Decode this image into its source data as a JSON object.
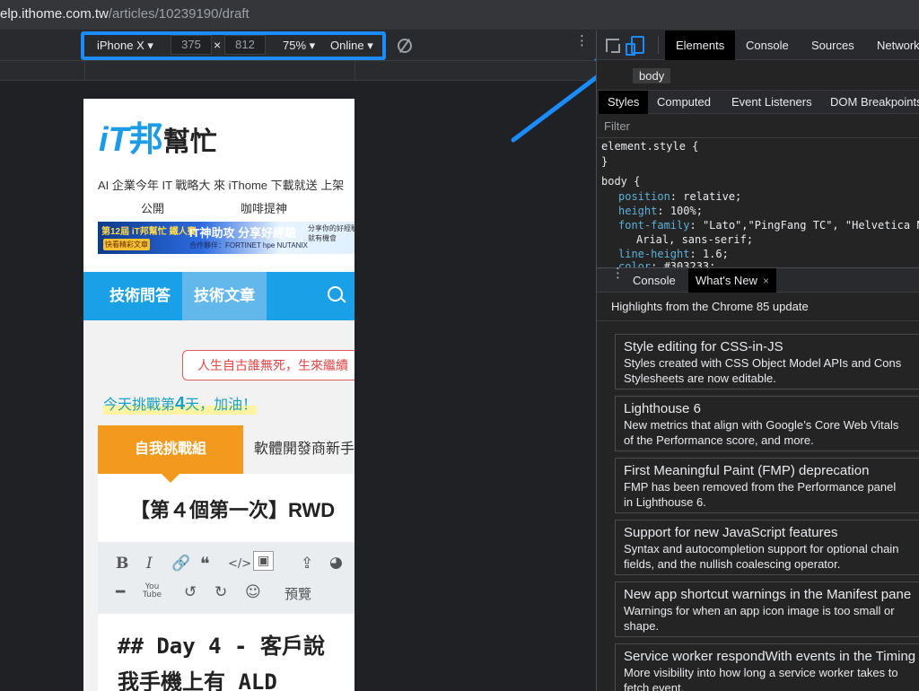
{
  "urlbar": {
    "url_domain": "elp.ithome.com.tw",
    "url_path": "/articles/10239190/draft"
  },
  "device_toolbar": {
    "device": "iPhone X",
    "width": "375",
    "times": "×",
    "height": "812",
    "zoom": "75%",
    "network": "Online",
    "more_icon": "⋮"
  },
  "phone": {
    "logo": {
      "it": "iT",
      "bang": "邦",
      "help": "幫忙"
    },
    "news_line1": "AI 企業今年 IT 戰略大  來 iThome 下載就送     上架",
    "news_line2_a": "公開",
    "news_line2_b": "咖啡提神",
    "banner": {
      "label": "第12屆 iT邦幫忙 鐵人賽",
      "button": "快看精彩文章>>",
      "headline": "IT神助攻 分享好經驗",
      "sponsors": "合作夥伴：FORTINET  hpe  NUTANIX",
      "right": "分享你的好經驗 就有機會"
    },
    "nav": {
      "tab1": "技術問答",
      "tab2": "技術文章",
      "search_icon": "search-icon"
    },
    "quote": "人生自古誰無死，生來繼續",
    "challenge_prefix": "今天挑戰第",
    "challenge_day": "4",
    "challenge_suffix": "天，加油！",
    "card": {
      "tab1": "自我挑戰組",
      "tab2": "軟體開發商新手",
      "title": "【第４個第一次】RWD",
      "toolbar_row1": [
        "B",
        "I",
        "link-icon",
        "quote-icon",
        "</>",
        "image-icon",
        "upload-icon",
        "chart-icon"
      ],
      "toolbar_row2": [
        "hr-icon",
        "youtube-icon",
        "undo-icon",
        "redo-icon",
        "emoji-icon",
        "預覽"
      ],
      "markdown1": "## Day 4 - 客戶說",
      "markdown2": "我手機上有 ALD"
    }
  },
  "devtools": {
    "tabs": [
      "Elements",
      "Console",
      "Sources",
      "Network"
    ],
    "breadcrumb": "body",
    "subtabs": [
      "Styles",
      "Computed",
      "Event Listeners",
      "DOM Breakpoints"
    ],
    "filter_placeholder": "Filter",
    "code": {
      "l1": "element.style {",
      "l2": "}",
      "l3": "body {",
      "p1": "position",
      "v1": "relative;",
      "p2": "height",
      "v2": "100%;",
      "p3": "font-family",
      "v3": "\"Lato\",\"PingFang TC\", \"Helvetica Ne",
      "v3b": "Arial, sans-serif;",
      "p4": "line-height",
      "v4": "1.6;",
      "p5": "color",
      "v5": "#303233;"
    },
    "drawer": {
      "tab_console": "Console",
      "tab_whatsnew": "What's New",
      "close": "×",
      "highlights": "Highlights from the Chrome 85 update",
      "items": [
        {
          "title": "Style editing for CSS-in-JS",
          "d1": "Styles created with CSS Object Model APIs and Cons",
          "d2": "Stylesheets are now editable."
        },
        {
          "title": "Lighthouse 6",
          "d1": "New metrics that align with Google’s Core Web Vitals",
          "d2": "of the Performance score, and more."
        },
        {
          "title": "First Meaningful Paint (FMP) deprecation",
          "d1": "FMP has been removed from the Performance panel",
          "d2": "in Lighthouse 6."
        },
        {
          "title": "Support for new JavaScript features",
          "d1": "Syntax and autocompletion support for optional chain",
          "d2": "fields, and the nullish coalescing operator."
        },
        {
          "title": "New app shortcut warnings in the Manifest pane",
          "d1": "Warnings for when an app icon image is too small or",
          "d2": "shape."
        },
        {
          "title": "Service worker respondWith events in the Timing",
          "d1": "More visibility into how long a service worker takes to",
          "d2": "fetch event."
        }
      ]
    }
  },
  "colors": {
    "accent": "#1a8cff",
    "brand": "#1aa0e6",
    "orange": "#f39a1e"
  }
}
